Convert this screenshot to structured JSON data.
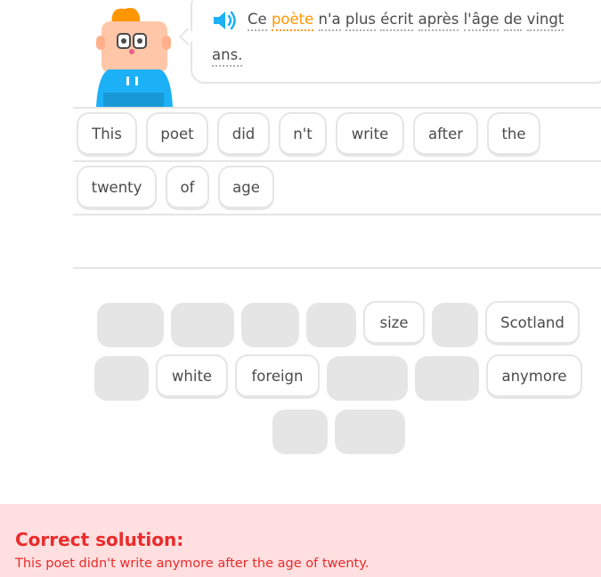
{
  "prompt": {
    "line1_words": [
      "Ce",
      "poète",
      "n'a",
      "plus",
      "écrit",
      "après",
      "l'âge",
      "de",
      "vingt"
    ],
    "line2_words": [
      "ans."
    ],
    "highlighted_word": "poète"
  },
  "answer": {
    "row1": [
      "This",
      "poet",
      "did",
      "n't",
      "write",
      "after",
      "the"
    ],
    "row2": [
      "twenty",
      "of",
      "age"
    ]
  },
  "word_bank": {
    "row1": [
      "",
      "",
      "",
      "",
      "size",
      "",
      "Scotland"
    ],
    "row2": [
      "",
      "white",
      "foreign",
      "",
      "",
      "anymore"
    ],
    "row3": [
      "",
      ""
    ]
  },
  "feedback": {
    "title": "Correct solution:",
    "solution": "This poet didn't write anymore after the age of twenty."
  },
  "colors": {
    "accent_highlight": "#ff9600",
    "speaker": "#1cb0f6",
    "error_text": "#ea2b2b",
    "error_background": "#ffdfe0",
    "border": "#e5e5e5"
  }
}
